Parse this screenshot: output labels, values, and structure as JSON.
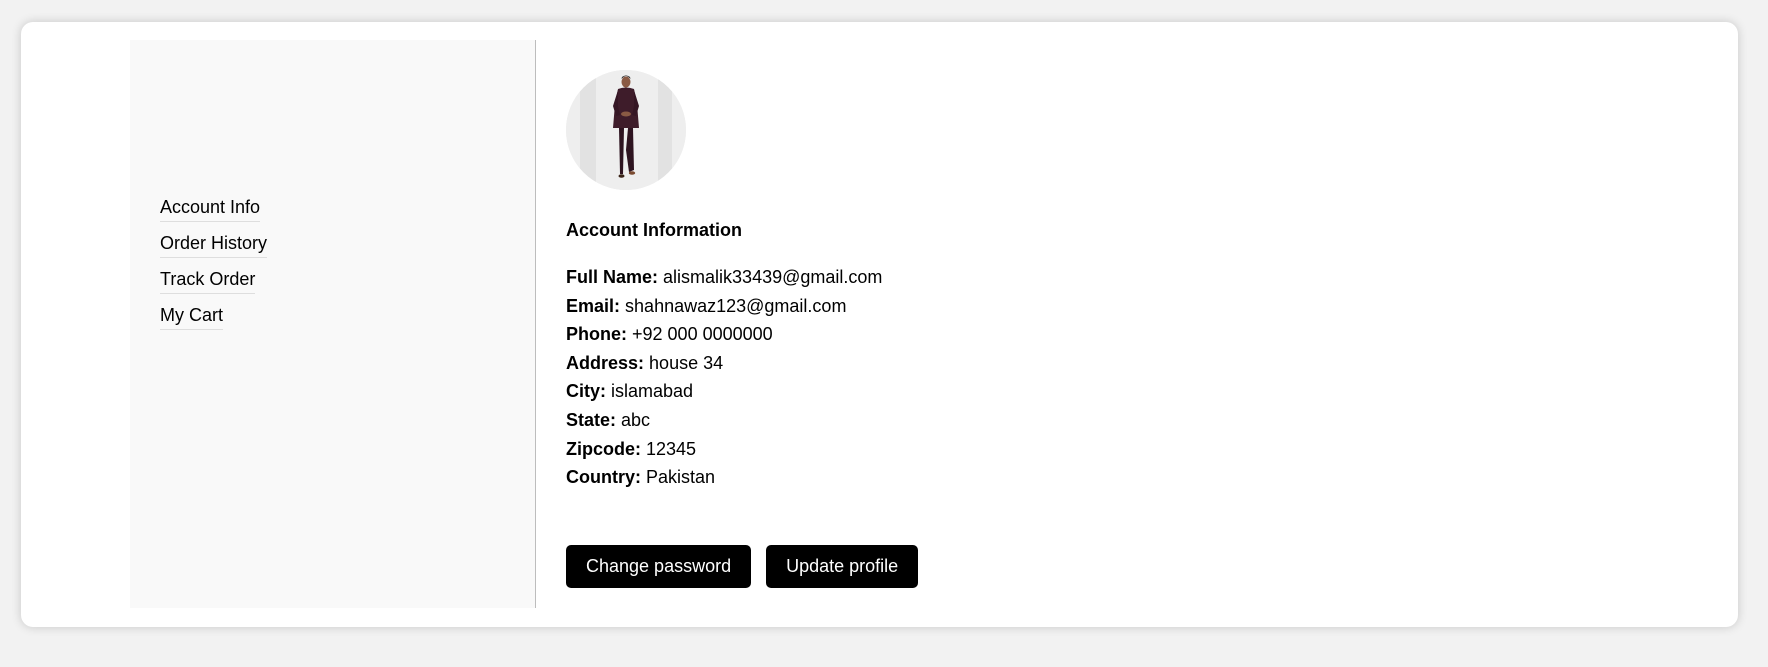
{
  "sidebar": {
    "items": [
      {
        "label": "Account Info"
      },
      {
        "label": "Order History"
      },
      {
        "label": "Track Order"
      },
      {
        "label": "My Cart"
      }
    ]
  },
  "profile": {
    "avatar_icon": "person-photo-icon",
    "section_title": "Account Information",
    "fields": [
      {
        "label": "Full Name:",
        "value": "alismalik33439@gmail.com"
      },
      {
        "label": "Email:",
        "value": "shahnawaz123@gmail.com"
      },
      {
        "label": "Phone:",
        "value": "+92 000 0000000"
      },
      {
        "label": "Address:",
        "value": "house 34"
      },
      {
        "label": "City:",
        "value": "islamabad"
      },
      {
        "label": "State:",
        "value": "abc"
      },
      {
        "label": "Zipcode:",
        "value": "12345"
      },
      {
        "label": "Country:",
        "value": "Pakistan"
      }
    ]
  },
  "actions": {
    "change_password": "Change password",
    "update_profile": "Update profile"
  },
  "colors": {
    "page_background": "#f2f2f2",
    "sidebar_background": "#f9f9f9",
    "button_background": "#000000",
    "button_text": "#ffffff"
  }
}
